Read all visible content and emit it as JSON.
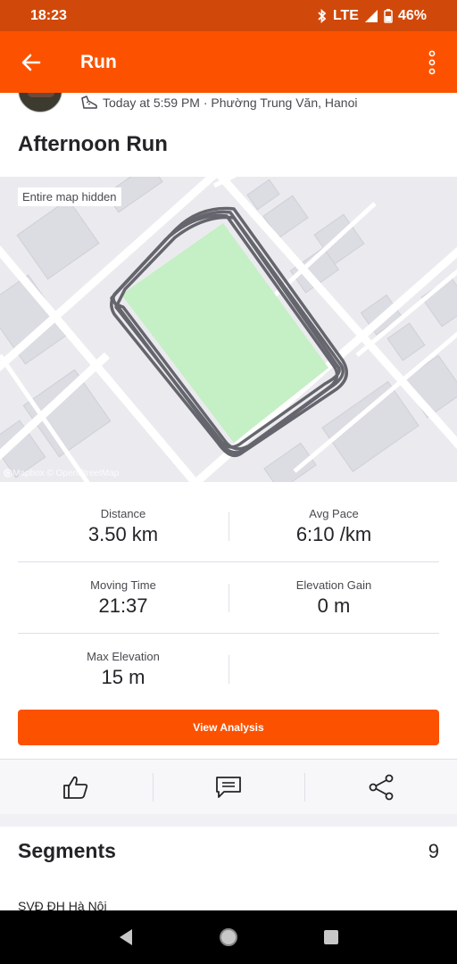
{
  "status_bar": {
    "time": "18:23",
    "network": "LTE",
    "battery": "46%"
  },
  "app_bar": {
    "title": "Run",
    "back_icon": "arrow-left-icon",
    "menu_icon": "more-vertical-icon"
  },
  "activity": {
    "meta": "Today at 5:59 PM · Phường Trung Văn, Hanoi",
    "meta_icon": "running-shoe-icon",
    "title": "Afternoon Run"
  },
  "map": {
    "label": "Entire map hidden",
    "attribution": "© Mapbox © OpenStreetMap"
  },
  "stats": {
    "distance": {
      "label": "Distance",
      "value": "3.50 km"
    },
    "avg_pace": {
      "label": "Avg Pace",
      "value": "6:10 /km"
    },
    "moving_time": {
      "label": "Moving Time",
      "value": "21:37"
    },
    "elevation_gain": {
      "label": "Elevation Gain",
      "value": "0 m"
    },
    "max_elevation": {
      "label": "Max Elevation",
      "value": "15 m"
    }
  },
  "buttons": {
    "view_analysis": "View Analysis"
  },
  "actions": {
    "kudos_icon": "thumbs-up-icon",
    "comment_icon": "comment-icon",
    "share_icon": "share-icon"
  },
  "segments": {
    "title": "Segments",
    "count": "9",
    "first_item": "SVĐ ĐH Hà Nội"
  },
  "colors": {
    "accent": "#fc5200",
    "status_bar": "#d1490a",
    "route": "#5a5a63",
    "area": "#c5efc4"
  }
}
